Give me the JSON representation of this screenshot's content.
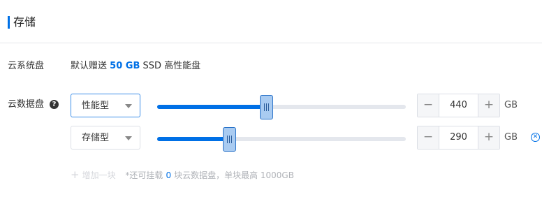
{
  "section": {
    "title": "存储"
  },
  "system_disk": {
    "label": "云系统盘",
    "prefix": "默认赠送",
    "size": "50 GB",
    "suffix": "SSD 高性能盘"
  },
  "data_disk": {
    "label": "云数据盘",
    "help_icon": "?",
    "disks": [
      {
        "type_label": "性能型",
        "value": "440",
        "unit": "GB",
        "fill_fraction": 0.44,
        "active": true
      },
      {
        "type_label": "存储型",
        "value": "290",
        "unit": "GB",
        "fill_fraction": 0.29,
        "active": false
      }
    ],
    "minus_label": "−",
    "plus_label": "+",
    "remove_icon": "✕"
  },
  "add_disk": {
    "plus": "+",
    "label": "增加一块",
    "note_prefix": "*还可挂载",
    "remaining": "0",
    "note_suffix": "块云数据盘，单块最高 1000GB"
  }
}
